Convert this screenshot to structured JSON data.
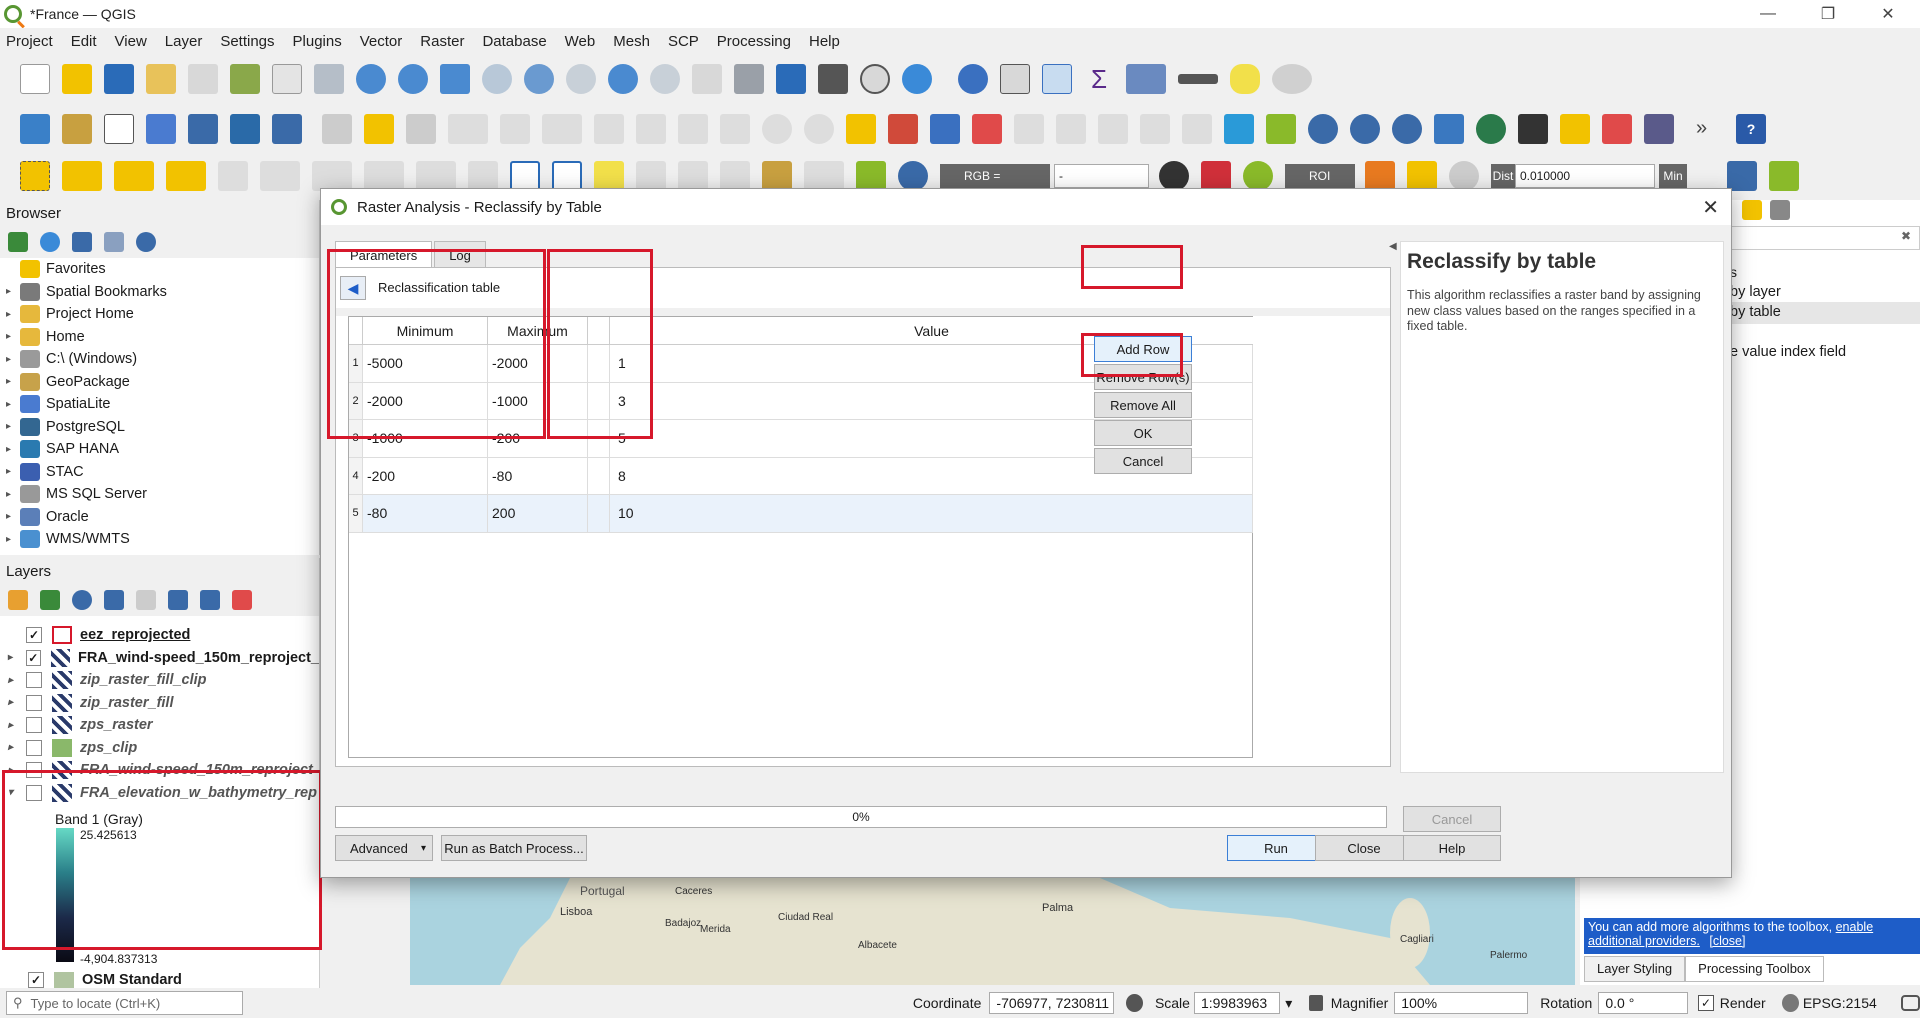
{
  "window": {
    "title": "*France — QGIS",
    "minimize": "—",
    "maximize": "❐",
    "close": "✕"
  },
  "menu": [
    "Project",
    "Edit",
    "View",
    "Layer",
    "Settings",
    "Plugins",
    "Vector",
    "Raster",
    "Database",
    "Web",
    "Mesh",
    "SCP",
    "Processing",
    "Help"
  ],
  "toolbar": {
    "rgb_label": "RGB =",
    "rgb_value": "-",
    "roi_label": "ROI",
    "dist_label": "Dist",
    "dist_value": "0.010000",
    "min_label": "Min"
  },
  "browser": {
    "title": "Browser",
    "items": [
      {
        "label": "Favorites",
        "icon": "star-icon",
        "color": "#f2c200"
      },
      {
        "label": "Spatial Bookmarks",
        "icon": "bookmark-icon",
        "color": "#7a7a7a"
      },
      {
        "label": "Project Home",
        "icon": "folder-icon",
        "color": "#e6b83c"
      },
      {
        "label": "Home",
        "icon": "folder-icon",
        "color": "#e6b83c"
      },
      {
        "label": "C:\\ (Windows)",
        "icon": "drive-icon",
        "color": "#9a9a9a"
      },
      {
        "label": "GeoPackage",
        "icon": "geopackage-icon",
        "color": "#c7a24a"
      },
      {
        "label": "SpatiaLite",
        "icon": "feather-icon",
        "color": "#4a7bd0"
      },
      {
        "label": "PostgreSQL",
        "icon": "elephant-icon",
        "color": "#336791"
      },
      {
        "label": "SAP HANA",
        "icon": "database-icon",
        "color": "#2a7ab0"
      },
      {
        "label": "STAC",
        "icon": "stac-icon",
        "color": "#3b5fb0"
      },
      {
        "label": "MS SQL Server",
        "icon": "server-icon",
        "color": "#999"
      },
      {
        "label": "Oracle",
        "icon": "oracle-icon",
        "color": "#5b7fb8"
      },
      {
        "label": "WMS/WMTS",
        "icon": "globe-icon",
        "color": "#4a90d0"
      }
    ]
  },
  "layers": {
    "title": "Layers",
    "items": [
      {
        "label": "eez_reprojected",
        "checked": "✓",
        "style": "bold"
      },
      {
        "label": "FRA_wind-speed_150m_reproject_",
        "checked": "✓",
        "style": "bold"
      },
      {
        "label": "zip_raster_fill_clip",
        "checked": "",
        "style": "italic"
      },
      {
        "label": "zip_raster_fill",
        "checked": "",
        "style": "italic"
      },
      {
        "label": "zps_raster",
        "checked": "",
        "style": "italic"
      },
      {
        "label": "zps_clip",
        "checked": "",
        "style": "italic"
      },
      {
        "label": "FRA_wind-speed_150m_reproject",
        "checked": "",
        "style": "italic"
      },
      {
        "label": "FRA_elevation_w_bathymetry_rep",
        "checked": "",
        "style": "italic"
      }
    ],
    "band_label": "Band 1 (Gray)",
    "max_value": "25.425613",
    "min_value": "-4,904.837313",
    "osm_label": "OSM Standard"
  },
  "dialog": {
    "title": "Raster Analysis - Reclassify by Table",
    "tabs": [
      "Parameters",
      "Log"
    ],
    "section_label": "Reclassification table",
    "columns": [
      "Minimum",
      "Maximum",
      "Value"
    ],
    "rows": [
      {
        "num": "1",
        "min": "-5000",
        "max": "-2000",
        "value": "1"
      },
      {
        "num": "2",
        "min": "-2000",
        "max": "-1000",
        "value": "3"
      },
      {
        "num": "3",
        "min": "-1000",
        "max": "-200",
        "value": "5"
      },
      {
        "num": "4",
        "min": "-200",
        "max": "-80",
        "value": "8"
      },
      {
        "num": "5",
        "min": "-80",
        "max": "200",
        "value": "10"
      }
    ],
    "buttons": {
      "add_row": "Add Row",
      "remove_rows": "Remove Row(s)",
      "remove_all": "Remove All",
      "ok": "OK",
      "cancel": "Cancel"
    },
    "help_title": "Reclassify by table",
    "help_text": "This algorithm reclassifies a raster band by assigning new class values based on the ranges specified in a fixed table.",
    "progress": "0%",
    "progress_cancel": "Cancel",
    "advanced": "Advanced",
    "batch": "Run as Batch Process...",
    "run": "Run",
    "close": "Close",
    "help": "Help"
  },
  "processing_panel": {
    "items": [
      "s",
      "by layer",
      "by table",
      "e value index field"
    ],
    "banner_text": "You can add more algorithms to the toolbox, ",
    "banner_link": "enable additional providers.",
    "banner_close": "[close]",
    "tabs": [
      "Layer Styling",
      "Processing Toolbox"
    ]
  },
  "map_labels": [
    "Portugal",
    "Lisboa",
    "Caceres",
    "Badajoz",
    "Merida",
    "Ciudad Real",
    "Albacete",
    "Palma",
    "Palermo",
    "Cagliari"
  ],
  "statusbar": {
    "locate_placeholder": "Type to locate (Ctrl+K)",
    "coordinate_label": "Coordinate",
    "coordinate_value": "-706977, 7230811",
    "scale_label": "Scale",
    "scale_value": "1:9983963",
    "magnifier_label": "Magnifier",
    "magnifier_value": "100%",
    "rotation_label": "Rotation",
    "rotation_value": "0.0 °",
    "render_label": "Render",
    "epsg": "EPSG:2154"
  },
  "colors": {
    "highlight": "#d6182b",
    "qgis_green": "#589632",
    "banner_blue": "#1e5dc8"
  }
}
